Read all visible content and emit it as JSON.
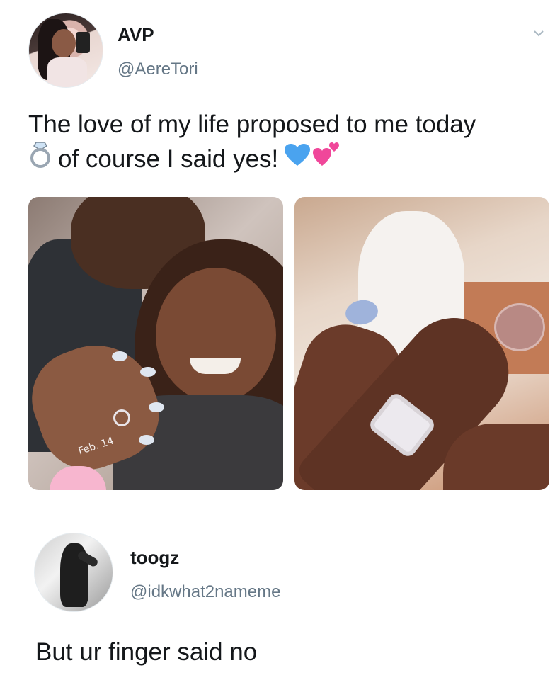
{
  "tweet": {
    "author": {
      "name": "AVP",
      "handle": "@AereTori"
    },
    "text_line1": "The love of my life proposed to me today",
    "text_line2": "of course I said yes!",
    "emojis": [
      "ring-icon",
      "blue-heart-icon",
      "two-hearts-icon"
    ],
    "photo_left_caption": "Feb. 14"
  },
  "reply": {
    "author": {
      "name": "toogz",
      "handle": "@idkwhat2nameme"
    },
    "text": "But ur finger said no"
  },
  "colors": {
    "handle_gray": "#657786",
    "text": "#14171a",
    "blue_heart": "#4aa3ef",
    "pink_hearts": "#f0479a"
  }
}
